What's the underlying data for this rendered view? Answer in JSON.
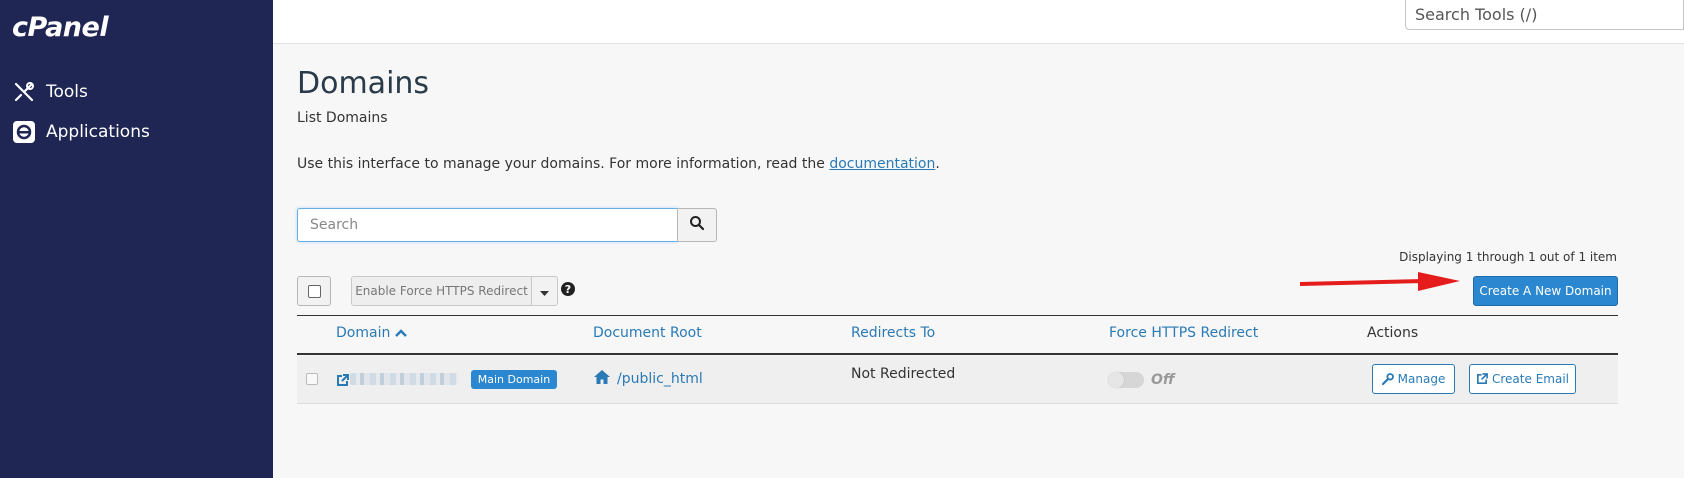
{
  "sidebar": {
    "logo": "cPanel",
    "items": [
      {
        "label": "Tools",
        "icon": "tools-icon"
      },
      {
        "label": "Applications",
        "icon": "applications-icon"
      }
    ]
  },
  "topbar": {
    "search_placeholder": "Search Tools (/)"
  },
  "page": {
    "title": "Domains",
    "subtitle": "List Domains",
    "intro_text": "Use this interface to manage your domains. For more information, read the ",
    "intro_link": "documentation",
    "intro_end": "."
  },
  "search": {
    "placeholder": "Search",
    "icon": "search-icon"
  },
  "toolbar": {
    "displaying": "Displaying 1 through 1 out of 1 item",
    "https_button": "Enable Force HTTPS Redirect",
    "help_glyph": "?",
    "create_button": "Create A New Domain"
  },
  "table": {
    "columns": [
      {
        "label": "Domain",
        "sortable": true,
        "sorted": "asc"
      },
      {
        "label": "Document Root",
        "sortable": true
      },
      {
        "label": "Redirects To",
        "sortable": true
      },
      {
        "label": "Force HTTPS Redirect",
        "sortable": true
      },
      {
        "label": "Actions",
        "sortable": false
      }
    ],
    "rows": [
      {
        "domain": "",
        "badge": "Main Domain",
        "document_root": "/public_html",
        "redirects_to": "Not Redirected",
        "force_https": "Off",
        "actions": [
          "Manage",
          "Create Email"
        ]
      }
    ]
  },
  "colors": {
    "sidebar_bg": "#1f2654",
    "accent": "#2b87cf",
    "link": "#2a7ab6",
    "annotation_arrow": "#e41c1c"
  }
}
